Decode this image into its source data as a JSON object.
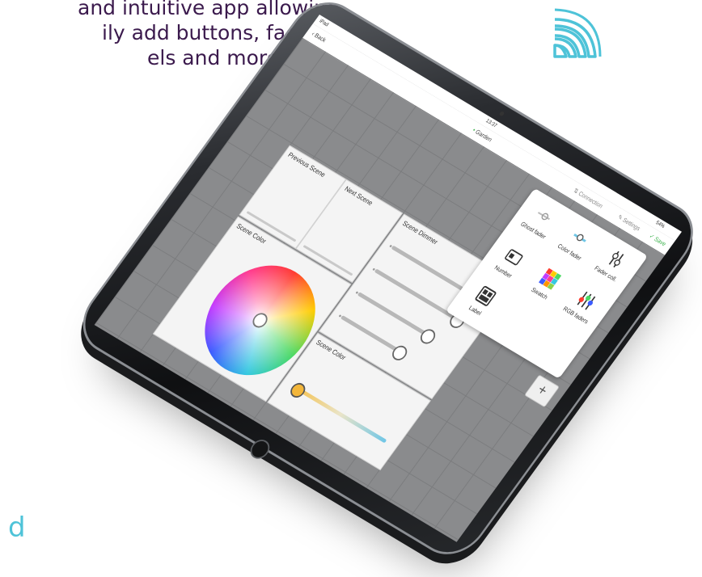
{
  "headline": {
    "line1": "and intuitive app allowing",
    "line2": "ily add buttons, faders,",
    "line3": "els and more."
  },
  "brand_fragment": "d",
  "icons": {
    "wifi": "wifi-icon",
    "home": "home-button-icon"
  },
  "colors": {
    "headline": "#3b1a4d",
    "accent": "#4ec3d8",
    "save": "#3fb34f"
  },
  "statusbar": {
    "carrier": "iPad",
    "time": "13:37",
    "battery": "54%"
  },
  "navbar": {
    "back": "Back",
    "title": "Garden",
    "connection": "Connection",
    "settings": "Settings",
    "save": "Save"
  },
  "tiles": {
    "previous_scene": "Previous Scene",
    "next_scene": "Next Scene",
    "scene_color": "Scene Color",
    "scene_dimmer": "Scene Dimmer",
    "scene_color_fader": "Scene Color"
  },
  "popup": {
    "items": [
      {
        "label": "Ghost fader",
        "icon": "ghost-fader-icon"
      },
      {
        "label": "Color fader",
        "icon": "color-fader-icon"
      },
      {
        "label": "Fader coll.",
        "icon": "fader-collection-icon"
      },
      {
        "label": "Number",
        "icon": "number-icon"
      },
      {
        "label": "Swatch",
        "icon": "swatch-icon"
      },
      {
        "label": "RGB faders",
        "icon": "rgb-faders-icon"
      },
      {
        "label": "Label",
        "icon": "label-icon"
      }
    ]
  },
  "add_button": "+"
}
